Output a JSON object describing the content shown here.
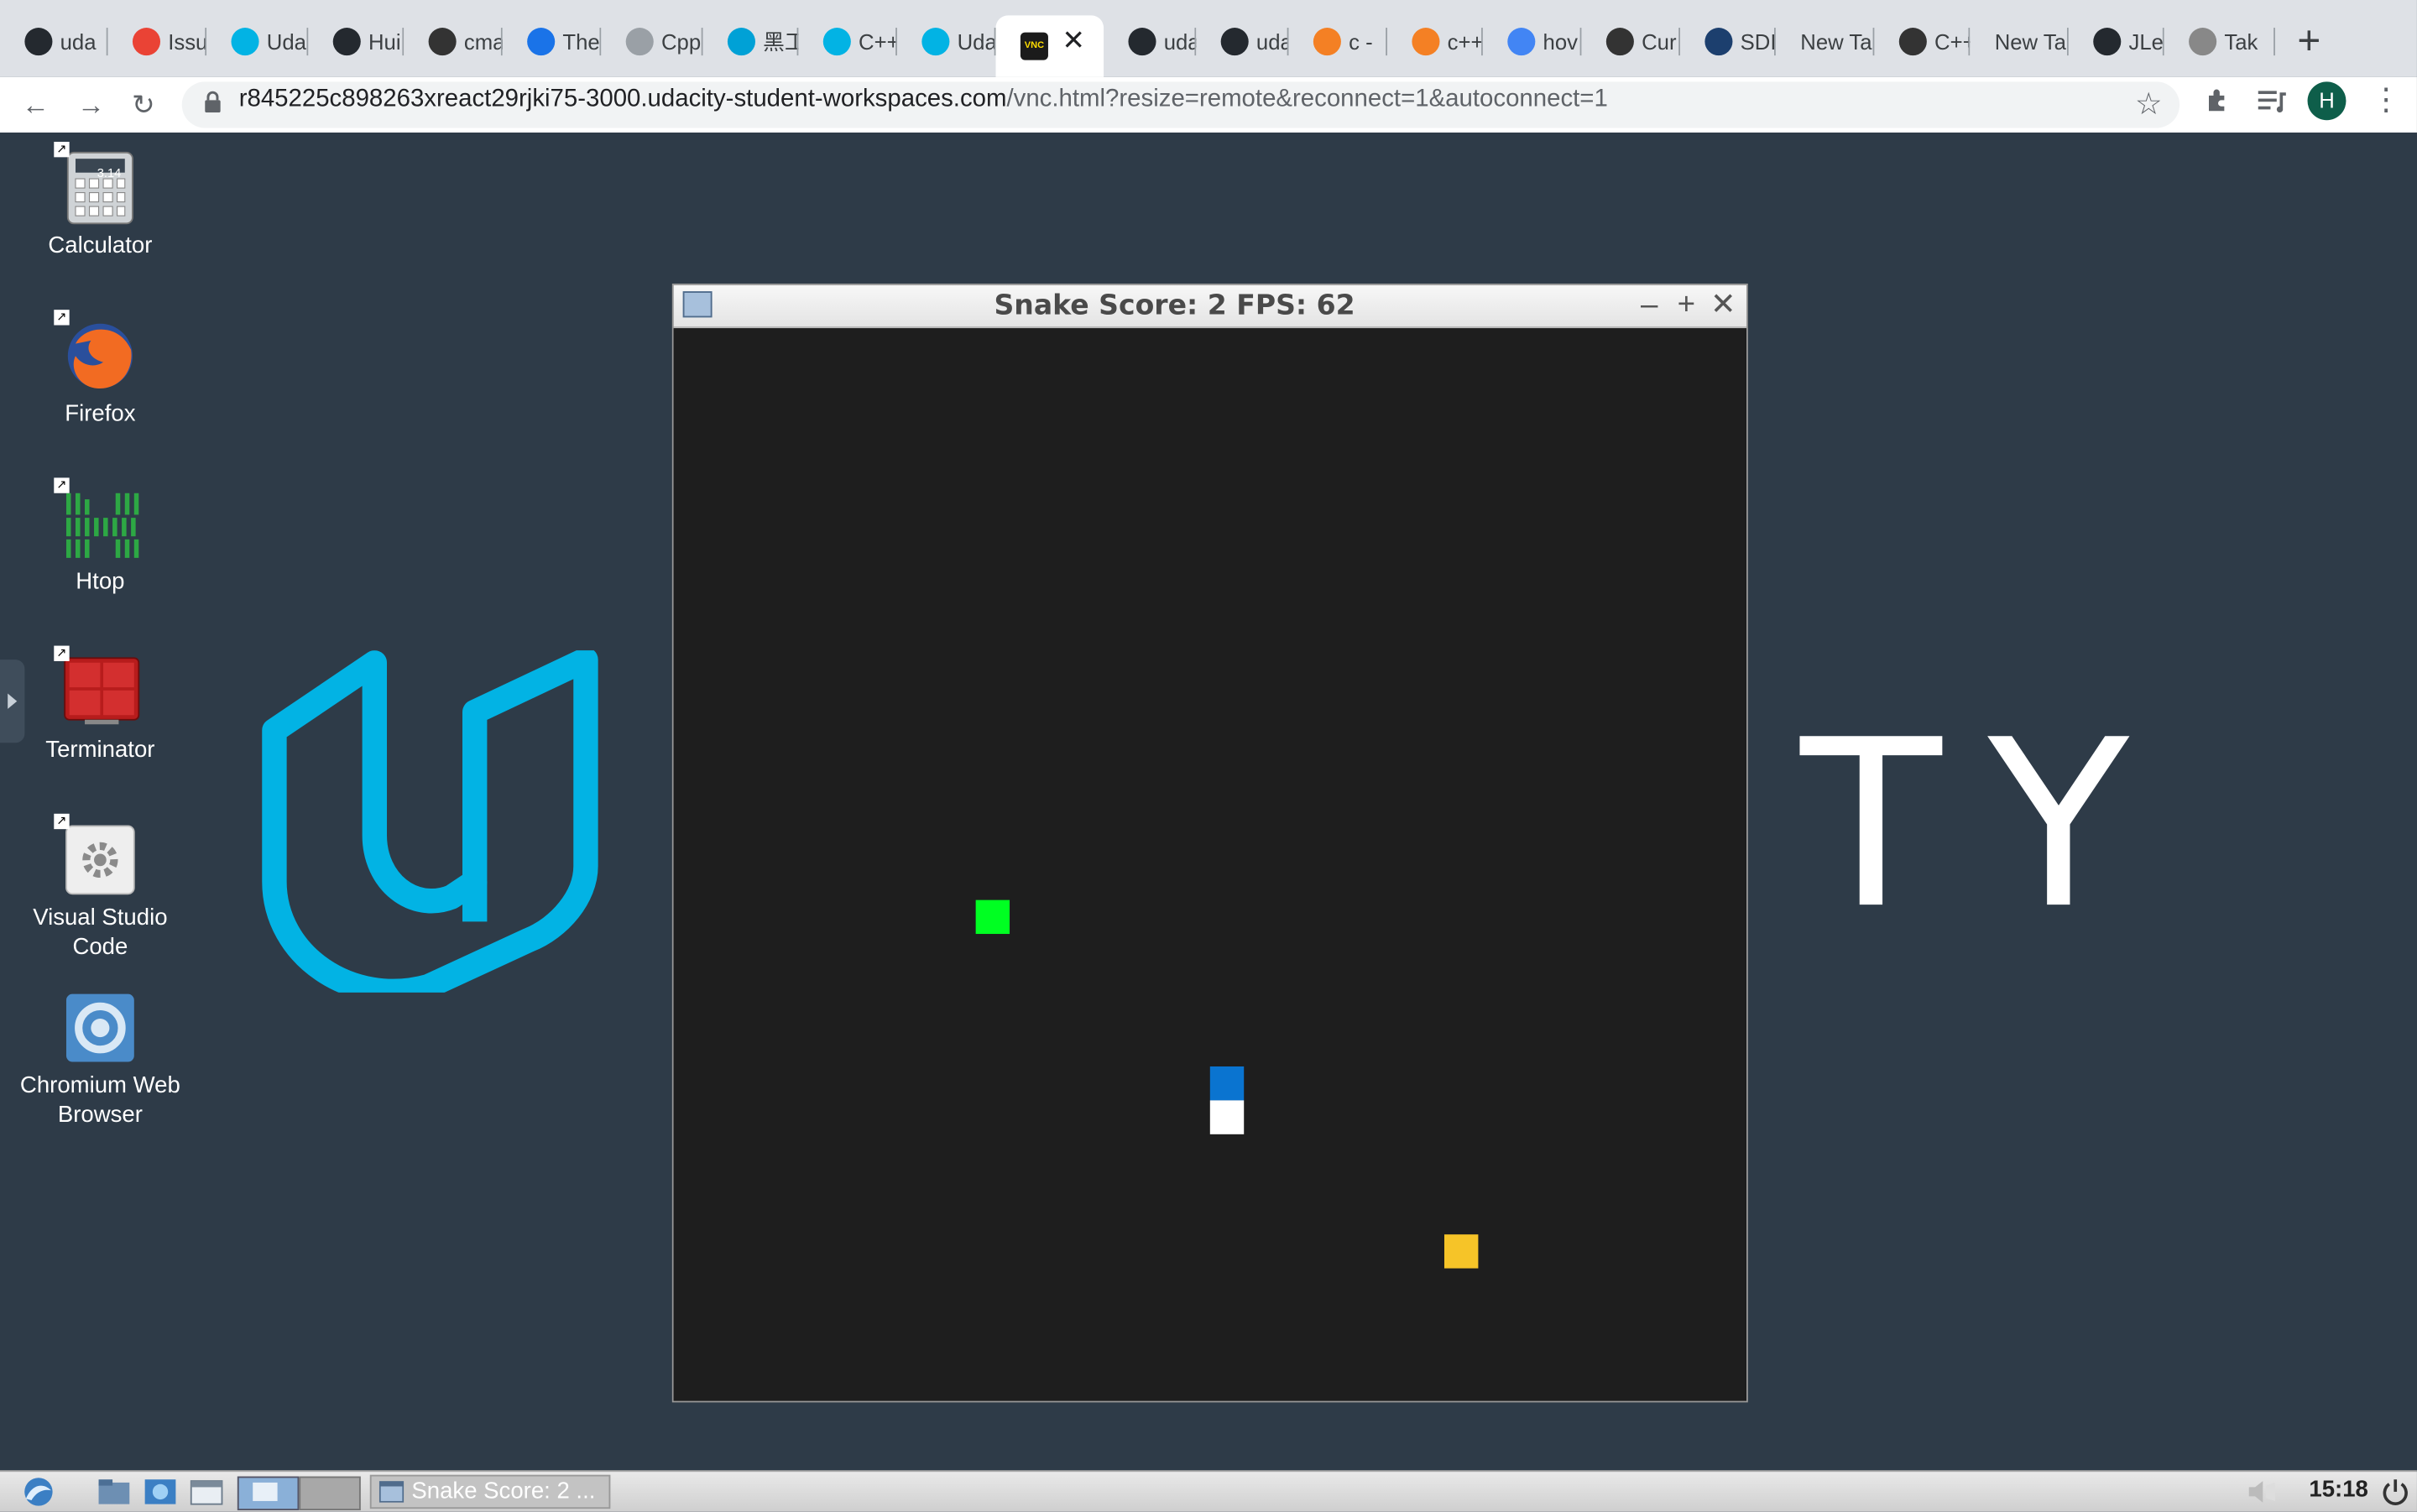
{
  "browser": {
    "tabs": [
      {
        "label": "uda",
        "icon": "github-icon",
        "color": "#24292f"
      },
      {
        "label": "Issu",
        "icon": "gmail-icon",
        "color": "#ea4335"
      },
      {
        "label": "Uda",
        "icon": "udacity-icon",
        "color": "#02b3e4"
      },
      {
        "label": "Hui",
        "icon": "github-icon",
        "color": "#24292f"
      },
      {
        "label": "cma",
        "icon": "cmake-icon",
        "color": "#333333"
      },
      {
        "label": "The",
        "icon": "mp-icon",
        "color": "#1a73e8"
      },
      {
        "label": "Cpp",
        "icon": "github-icon",
        "color": "#9aa0a6"
      },
      {
        "label": "黑工",
        "icon": "bilibili-icon",
        "color": "#00a1d6"
      },
      {
        "label": "C++",
        "icon": "udacity-icon",
        "color": "#02b3e4"
      },
      {
        "label": "Uda",
        "icon": "udacity-icon",
        "color": "#02b3e4"
      },
      {
        "label": "",
        "icon": "vnc-icon",
        "color": "#1b1b1b",
        "active": true
      },
      {
        "label": "uda",
        "icon": "github-icon",
        "color": "#24292f"
      },
      {
        "label": "uda",
        "icon": "github-icon",
        "color": "#24292f"
      },
      {
        "label": "c -",
        "icon": "stackoverflow-icon",
        "color": "#f48024"
      },
      {
        "label": "c++",
        "icon": "stackoverflow-icon",
        "color": "#f48024"
      },
      {
        "label": "hov",
        "icon": "google-icon",
        "color": "#4285f4"
      },
      {
        "label": "Cur",
        "icon": "cursor-icon",
        "color": "#333333"
      },
      {
        "label": "SDI",
        "icon": "sdl-icon",
        "color": "#1c3f6e"
      },
      {
        "label": "New Ta",
        "icon": "",
        "color": ""
      },
      {
        "label": "C++",
        "icon": "cplusplus-icon",
        "color": "#333333"
      },
      {
        "label": "New Ta",
        "icon": "",
        "color": ""
      },
      {
        "label": "JLe",
        "icon": "github-icon",
        "color": "#24292f"
      },
      {
        "label": "Tak",
        "icon": "apple-icon",
        "color": "#888888"
      }
    ],
    "url_host": "r845225c898263xreact29rjki75-3000.udacity-student-workspaces.com",
    "url_path": "/vnc.html?resize=remote&reconnect=1&autoconnect=1",
    "profile_initial": "H"
  },
  "desktop": {
    "icons": [
      {
        "label": "Calculator",
        "icon": "calculator-icon"
      },
      {
        "label": "Firefox",
        "icon": "firefox-icon"
      },
      {
        "label": "Htop",
        "icon": "htop-icon"
      },
      {
        "label": "Terminator",
        "icon": "terminator-icon"
      },
      {
        "label": "Visual Studio Code",
        "icon": "vscode-icon"
      },
      {
        "label": "Chromium Web Browser",
        "icon": "chromium-icon"
      }
    ],
    "calculator_display": "3.14",
    "wallpaper_text": "TY",
    "wallpaper_color": "#02b3e4"
  },
  "game_window": {
    "title": "Snake Score: 2 FPS: 62",
    "food_color": "#00ff22",
    "snake_head_color": "#0a74d0",
    "snake_body_color": "#ffffff",
    "extra_food_color": "#f6c428"
  },
  "taskbar": {
    "task_label": "Snake Score: 2 ...",
    "clock": "15:18"
  }
}
